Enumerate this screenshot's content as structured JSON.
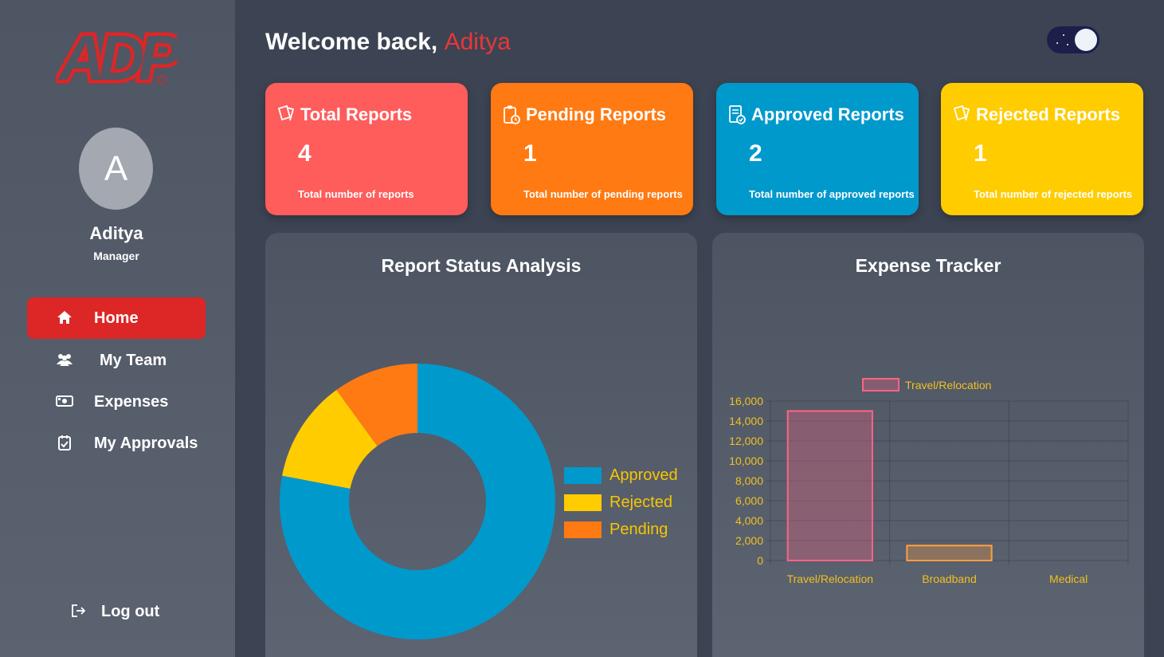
{
  "sidebar": {
    "logo_text": "ADP",
    "avatar_initial": "A",
    "user_name": "Aditya",
    "user_role": "Manager",
    "nav": [
      {
        "label": "Home",
        "icon": "home-icon",
        "active": true
      },
      {
        "label": "My Team",
        "icon": "team-icon",
        "active": false
      },
      {
        "label": "Expenses",
        "icon": "money-icon",
        "active": false
      },
      {
        "label": "My Approvals",
        "icon": "calendar-check-icon",
        "active": false
      }
    ],
    "logout_label": "Log out"
  },
  "header": {
    "welcome_prefix": "Welcome back,",
    "welcome_name": "Aditya",
    "theme_toggle": "dark"
  },
  "cards": [
    {
      "title": "Total Reports",
      "value": "4",
      "desc": "Total number of reports",
      "color": "#ff5c5c",
      "icon": "tickets-icon"
    },
    {
      "title": "Pending Reports",
      "value": "1",
      "desc": "Total number of pending reports",
      "color": "#ff7a12",
      "icon": "clipboard-clock-icon"
    },
    {
      "title": "Approved Reports",
      "value": "2",
      "desc": "Total number of approved reports",
      "color": "#0099cc",
      "icon": "document-check-icon"
    },
    {
      "title": "Rejected Reports",
      "value": "1",
      "desc": "Total number of rejected reports",
      "color": "#ffcc00",
      "icon": "tickets-icon"
    }
  ],
  "panels": {
    "status_title": "Report Status Analysis",
    "expense_title": "Expense Tracker"
  },
  "chart_data": [
    {
      "type": "pie",
      "title": "Report Status Analysis",
      "donut": true,
      "categories": [
        "Approved",
        "Rejected",
        "Pending"
      ],
      "values": [
        2,
        1,
        1
      ],
      "display_fractions": [
        0.78,
        0.12,
        0.1
      ],
      "colors": [
        "#0099cc",
        "#ffcc00",
        "#ff7a12"
      ],
      "legend": "right"
    },
    {
      "type": "bar",
      "title": "Expense Tracker",
      "categories": [
        "Travel/Relocation",
        "Broadband",
        "Medical"
      ],
      "series": [
        {
          "name": "Travel/Relocation",
          "values": [
            15000,
            1500,
            0
          ]
        }
      ],
      "bar_colors": [
        "rgba(255,99,132,0.3)",
        "rgba(255,159,64,0.3)",
        "rgba(255,205,86,0.3)"
      ],
      "border_colors": [
        "#ff6384",
        "#ff9f40",
        "#ffcd56"
      ],
      "ylim": [
        0,
        16000
      ],
      "yticks": [
        "0",
        "2,000",
        "4,000",
        "6,000",
        "8,000",
        "10,000",
        "12,000",
        "14,000",
        "16,000"
      ],
      "grid": true,
      "legend": "top"
    }
  ]
}
